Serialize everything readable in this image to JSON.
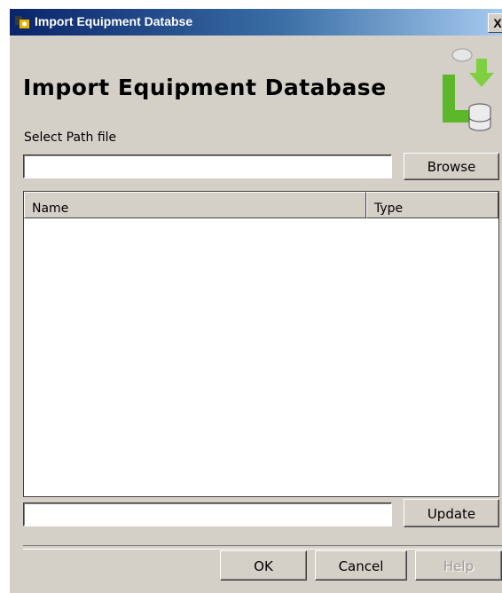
{
  "window": {
    "title": "Import Equipment Databse",
    "close_label": "X"
  },
  "header": {
    "heading": "Import Equipment Database",
    "logo_icon": "import-database-icon"
  },
  "path": {
    "label": "Select Path file",
    "value": "",
    "browse_label": "Browse"
  },
  "table": {
    "columns": [
      "Name",
      "Type"
    ],
    "rows": []
  },
  "update": {
    "value": "",
    "button_label": "Update"
  },
  "footer": {
    "ok_label": "OK",
    "cancel_label": "Cancel",
    "help_label": "Help"
  },
  "colors": {
    "titlebar_start": "#0a246a",
    "titlebar_end": "#a6caf0",
    "window_bg": "#d4d0c8",
    "logo_green": "#5cb82a"
  }
}
